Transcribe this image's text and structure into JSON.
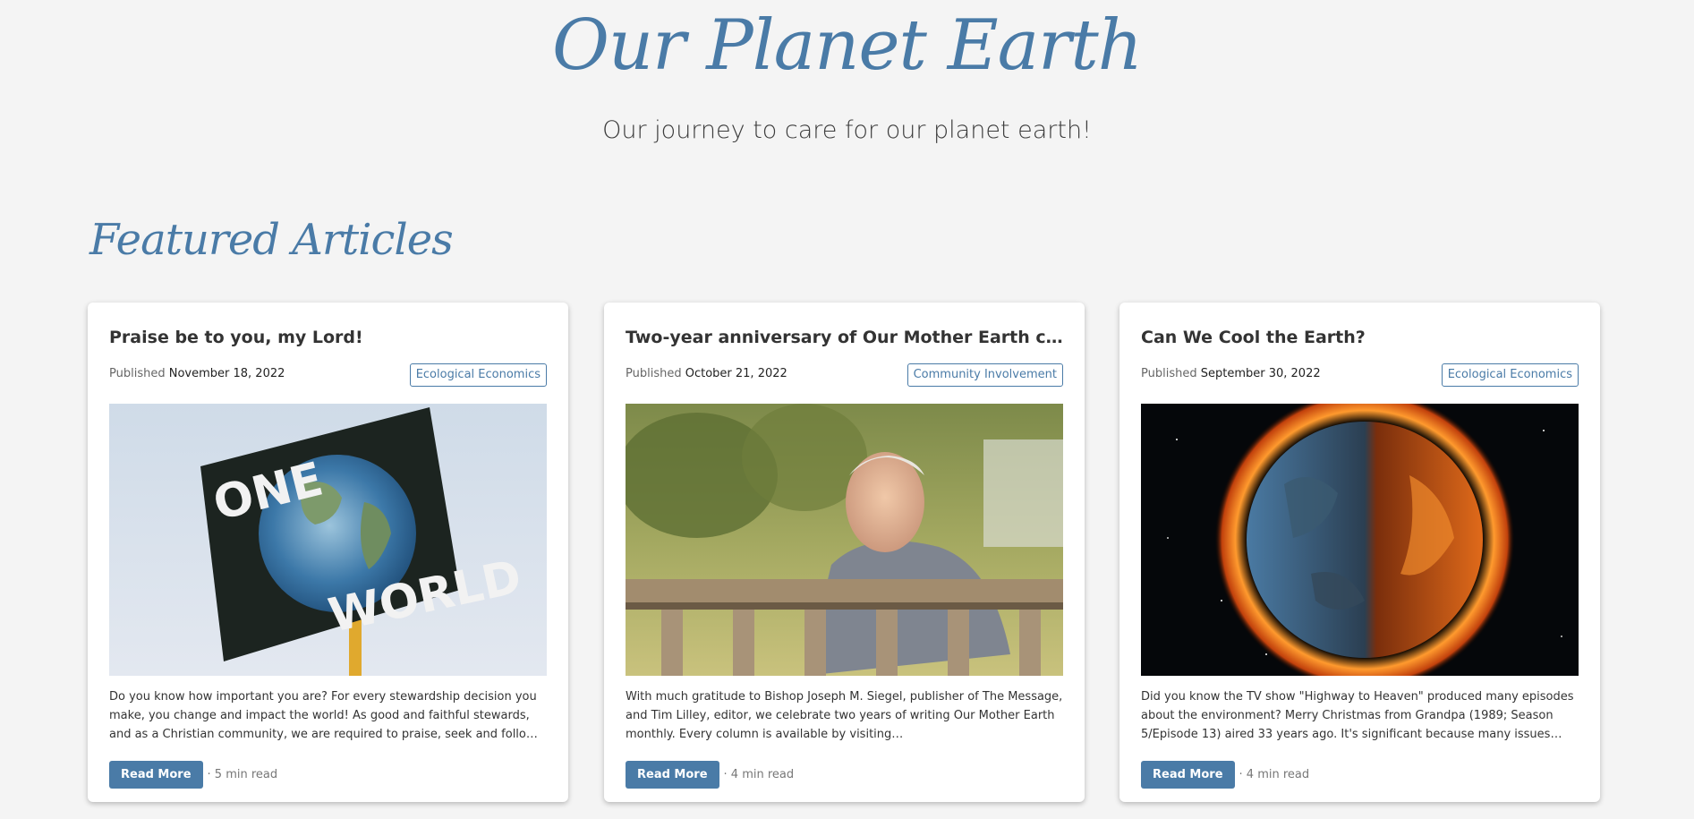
{
  "site": {
    "title": "Our Planet Earth",
    "tagline": "Our journey to care for our planet earth!"
  },
  "section": {
    "title": "Featured Articles"
  },
  "colors": {
    "accent": "#4a7ba7",
    "background": "#f4f4f4"
  },
  "articles": [
    {
      "title": "Praise be to you, my Lord!",
      "published_label": "Published",
      "date": "November 18, 2022",
      "category": "Ecological Economics",
      "image": "one-world-protest-sign-image",
      "image_text_1": "ONE",
      "image_text_2": "WORLD",
      "excerpt": "Do you know how important you are? For every stewardship decision you make, you change and impact the world! As good and faithful stewards, and as a Christian community, we are required to praise, seek and follow God in everything we do.",
      "button": "Read More",
      "read_time": "· 5 min read"
    },
    {
      "title": "Two-year anniversary of Our Mother Earth column",
      "published_label": "Published",
      "date": "October 21, 2022",
      "category": "Community Involvement",
      "image": "man-on-bench-photo",
      "excerpt": "With much gratitude to Bishop Joseph M. Siegel, publisher of The Message, and Tim Lilley, editor, we celebrate two years of writing Our Mother Earth monthly. Every column is available by visiting https://evdiomessage.org/our-mother-earth/",
      "button": "Read More",
      "read_time": "· 4 min read"
    },
    {
      "title": "Can We Cool the Earth?",
      "published_label": "Published",
      "date": "September 30, 2022",
      "category": "Ecological Economics",
      "image": "burning-earth-image",
      "excerpt": "Did you know the TV show \"Highway to Heaven\" produced many episodes about the environment? Merry Christmas from Grandpa (1989; Season 5/Episode 13) aired 33 years ago. It's significant because many issues then  - exist today....",
      "button": "Read More",
      "read_time": "· 4 min read"
    }
  ]
}
